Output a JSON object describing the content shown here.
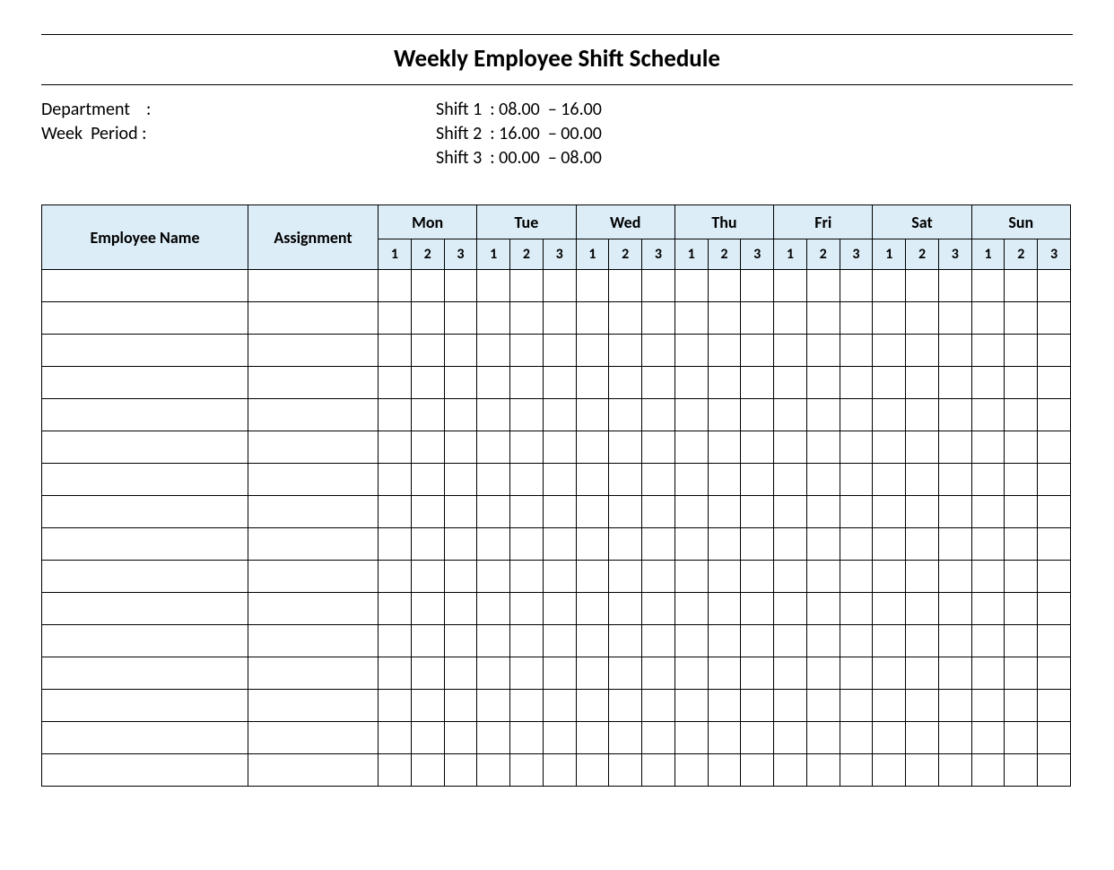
{
  "title": "Weekly Employee Shift Schedule",
  "meta": {
    "department_label": "Department    :",
    "week_period_label": "Week  Period :",
    "shift1": "Shift 1  : 08.00  – 16.00",
    "shift2": "Shift 2  : 16.00  – 00.00",
    "shift3": "Shift 3  : 00.00  – 08.00"
  },
  "headers": {
    "employee_name": "Employee Name",
    "assignment": "Assignment",
    "days": [
      "Mon",
      "Tue",
      "Wed",
      "Thu",
      "Fri",
      "Sat",
      "Sun"
    ],
    "shifts": [
      "1",
      "2",
      "3"
    ]
  },
  "row_count": 16
}
